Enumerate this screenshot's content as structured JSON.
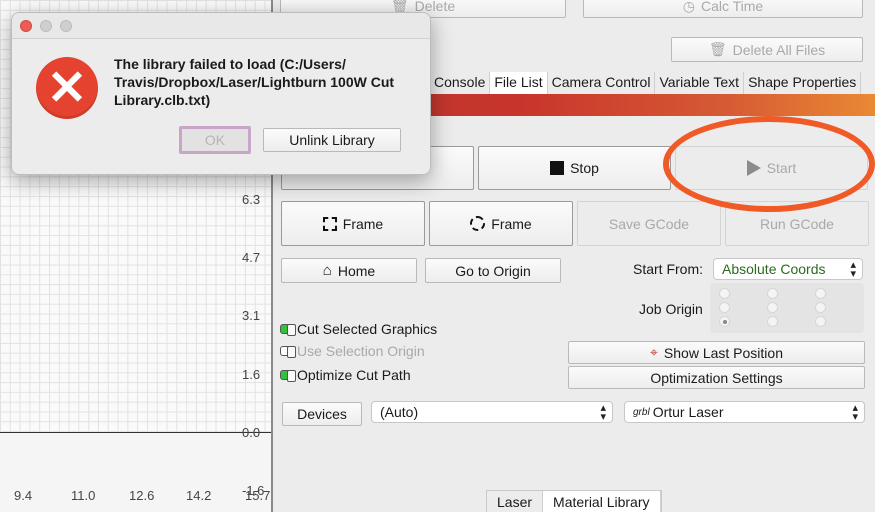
{
  "canvas": {
    "y_ticks": [
      "6.3",
      "4.7",
      "3.1",
      "1.6",
      "0.0",
      "-1.6"
    ],
    "x_ticks": [
      "9.4",
      "11.0",
      "12.6",
      "14.2",
      "15.7"
    ]
  },
  "top_buttons": {
    "delete": "Delete",
    "calc_time": "Calc Time",
    "delete_all_files": "Delete All Files"
  },
  "tabs": [
    "Console",
    "File List",
    "Camera Control",
    "Variable Text",
    "Shape Properties"
  ],
  "laser_controls": {
    "stop": "Stop",
    "start": "Start",
    "frame1": "Frame",
    "frame2": "Frame",
    "save_gcode": "Save GCode",
    "run_gcode": "Run GCode",
    "home": "Home",
    "go_to_origin": "Go to Origin",
    "start_from_label": "Start From:",
    "start_from_value": "Absolute Coords",
    "job_origin_label": "Job Origin",
    "cut_selected": "Cut Selected Graphics",
    "use_selection_origin": "Use Selection Origin",
    "optimize_cut_path": "Optimize Cut Path",
    "show_last_position": "Show Last Position",
    "optimization_settings": "Optimization Settings",
    "devices": "Devices",
    "port_value": "(Auto)",
    "device_value": "Ortur Laser",
    "grbl_prefix": "grbl"
  },
  "bottom_tabs": [
    "Laser",
    "Material Library"
  ],
  "dialog": {
    "message": "The library failed to load (C:/Users/ Travis/Dropbox/Laser/Lightburn 100W Cut Library.clb.txt)",
    "ok": "OK",
    "unlink": "Unlink Library"
  },
  "colors": {
    "annotation_ring": "#ef5a27",
    "error_icon": "#e5432f",
    "check_on": "#37c13a"
  }
}
